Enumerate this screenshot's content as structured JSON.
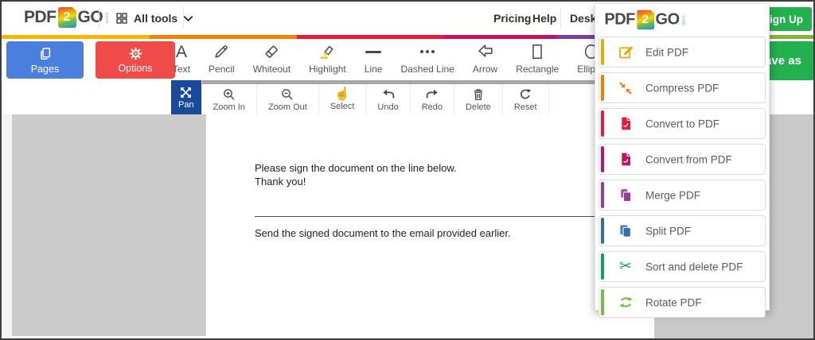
{
  "header": {
    "logo": {
      "pdf": "PDF",
      "num": "2",
      "go": "GO",
      "tld": ".com"
    },
    "all_tools": "All tools",
    "pricing": "Pricing",
    "help": "Help",
    "desktop": "Desktop",
    "sign_up": "Sign Up"
  },
  "stripe_colors": [
    "#f7b500",
    "#f28200",
    "#e8193c",
    "#c01362",
    "#7d3f98",
    "#3a6db5",
    "#8cb03b"
  ],
  "toolbar": {
    "pages": "Pages",
    "options": "Options",
    "save_as": "Save as",
    "tools": [
      {
        "label": "Text",
        "icon": "text-icon"
      },
      {
        "label": "Pencil",
        "icon": "pencil-icon"
      },
      {
        "label": "Whiteout",
        "icon": "eraser-icon"
      },
      {
        "label": "Highlight",
        "icon": "highlighter-icon"
      },
      {
        "label": "Line",
        "icon": "line-icon"
      },
      {
        "label": "Dashed Line",
        "icon": "dashed-line-icon"
      },
      {
        "label": "Arrow",
        "icon": "arrow-icon"
      },
      {
        "label": "Rectangle",
        "icon": "rectangle-icon"
      },
      {
        "label": "Ellipse",
        "icon": "ellipse-icon"
      }
    ]
  },
  "canvas_toolbar": {
    "active_tool": "Pan",
    "items": [
      {
        "label": "Pan",
        "icon": "pan-icon"
      },
      {
        "label": "Zoom In",
        "icon": "zoom-in-icon"
      },
      {
        "label": "Zoom Out",
        "icon": "zoom-out-icon"
      },
      {
        "label": "Select",
        "icon": "select-hand-icon"
      },
      {
        "label": "Undo",
        "icon": "undo-icon"
      },
      {
        "label": "Redo",
        "icon": "redo-icon"
      },
      {
        "label": "Delete",
        "icon": "trash-icon"
      },
      {
        "label": "Reset",
        "icon": "reset-icon"
      }
    ]
  },
  "document": {
    "paragraph1_line1": "Please sign the document on the line below.",
    "paragraph1_line2": "Thank you!",
    "paragraph2": "Send the signed document to the email provided earlier."
  },
  "tools_menu": {
    "items": [
      {
        "label": "Edit PDF",
        "color": "#f2a30a",
        "icon": "edit-pdf-icon"
      },
      {
        "label": "Compress PDF",
        "color": "#ef7d00",
        "icon": "compress-pdf-icon"
      },
      {
        "label": "Convert to PDF",
        "color": "#e8193c",
        "icon": "pdf-file-icon"
      },
      {
        "label": "Convert from PDF",
        "color": "#c01362",
        "icon": "pdf-file-icon"
      },
      {
        "label": "Merge PDF",
        "color": "#8f3f97",
        "icon": "merge-pdf-icon"
      },
      {
        "label": "Split PDF",
        "color": "#2f6db3",
        "icon": "split-pdf-icon"
      },
      {
        "label": "Sort and delete PDF",
        "color": "#0da05f",
        "icon": "scissors-icon"
      },
      {
        "label": "Rotate PDF",
        "color": "#72bf44",
        "icon": "rotate-pdf-icon"
      }
    ]
  },
  "colors": {
    "accent_green": "#23b14e",
    "primary_blue": "#4a7fe0",
    "danger_red": "#f14b49",
    "active_blue": "#17499c"
  },
  "scissors_glyph": "✂",
  "select_glyph": "☝"
}
